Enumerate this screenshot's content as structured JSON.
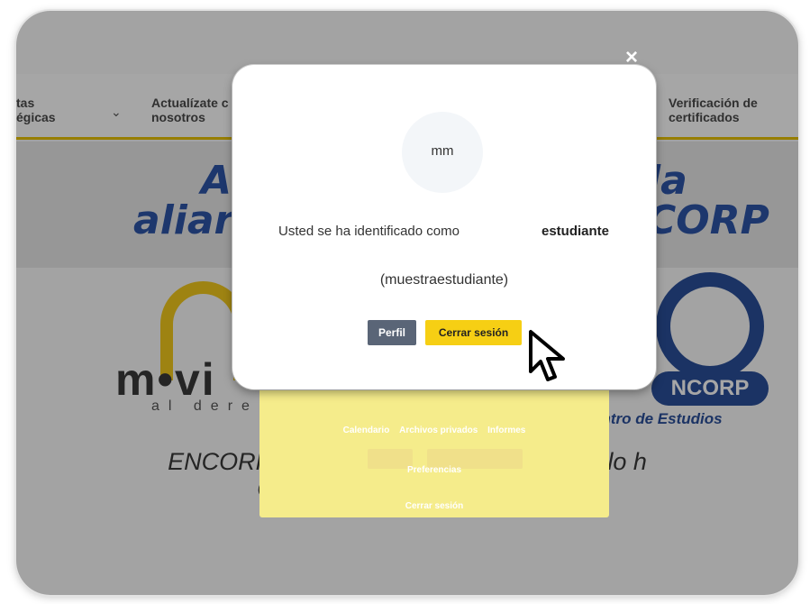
{
  "nav": {
    "item1": [
      "tas",
      "égicas"
    ],
    "item2": [
      "Actualízate c",
      "nosotros"
    ],
    "item3": [
      "Verificación de",
      "certificados"
    ]
  },
  "hero": {
    "line1_left": "A",
    "line1_right": "la",
    "line2_left": "aliar",
    "line2_right": "CORP"
  },
  "logos": {
    "movi_word": "m•vi",
    "movi_sub": "al dere",
    "encorp_pill": "NCORP",
    "encorp_sub": "entro de Estudios"
  },
  "tagline": {
    "line1": "ENCORP institución ed                                                   rabajo y desarrollo h",
    "line2": "Que cuenta                                                                    a de Educación"
  },
  "dropdown": {
    "links": [
      "Calendario",
      "Archivos privados",
      "Informes"
    ],
    "preferences": "Preferencias",
    "logout": "Cerrar sesión"
  },
  "modal": {
    "close": "×",
    "avatar_initials": "mm",
    "identified_as": "Usted se ha identificado como",
    "role": "estudiante",
    "username": "(muestraestudiante)",
    "profile_button": "Perfil",
    "logout_button": "Cerrar sesión"
  },
  "colors": {
    "accent_yellow": "#f6cf14",
    "profile_button_bg": "#5a6577",
    "brand_blue": "#2a4f9a"
  }
}
